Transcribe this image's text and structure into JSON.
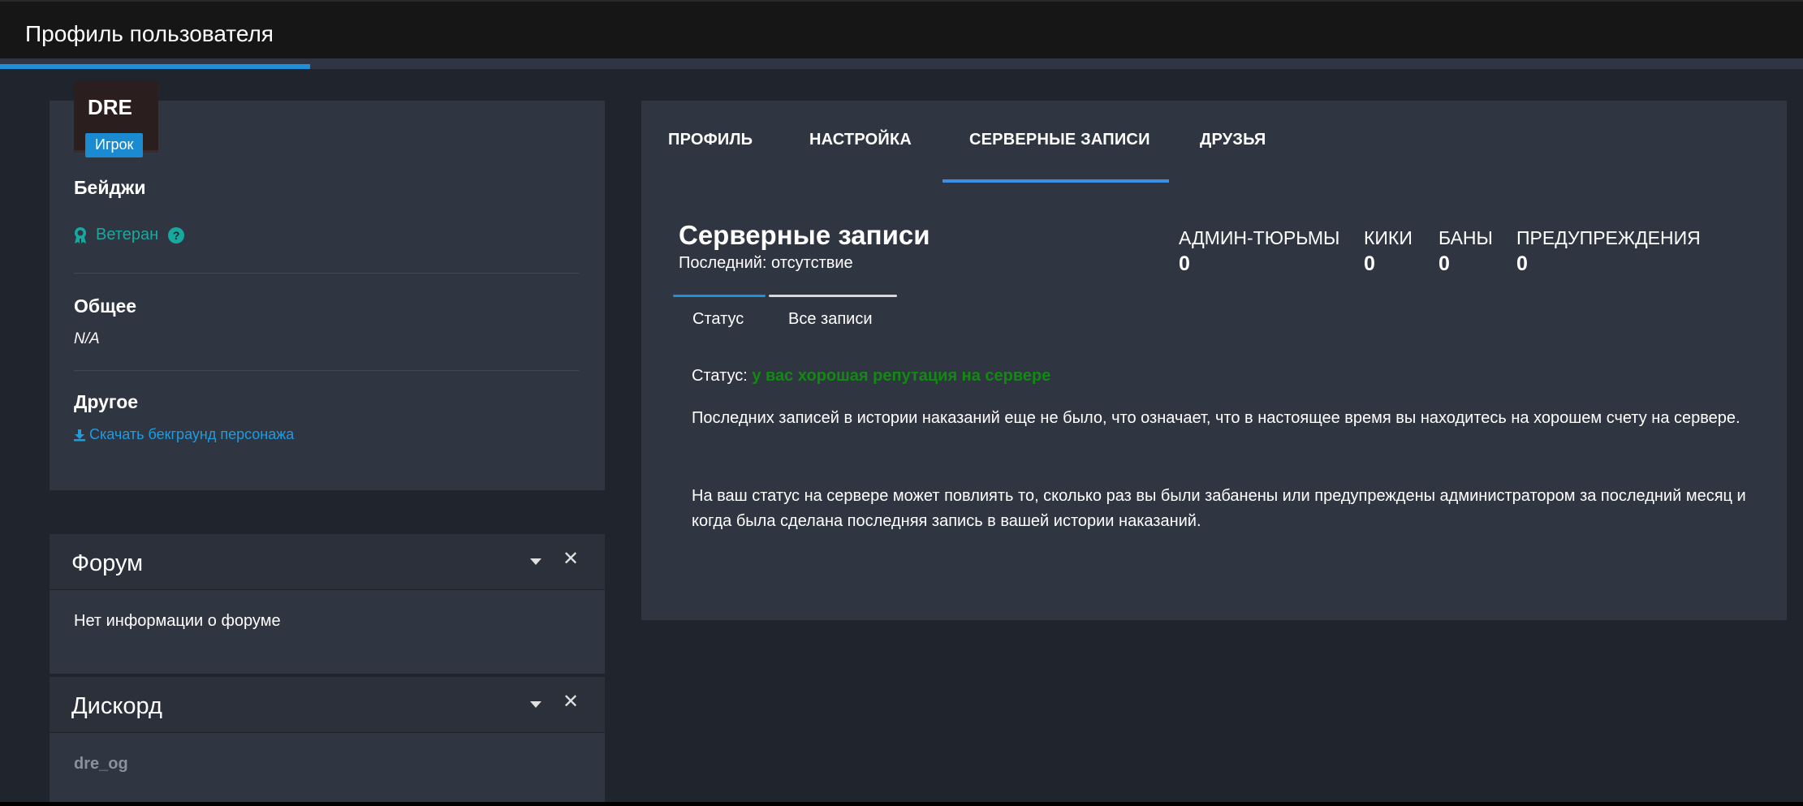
{
  "header": {
    "title": "Профиль пользователя"
  },
  "profile": {
    "name": "DRE",
    "role": "Игрок",
    "badges_title": "Бейджи",
    "badge": {
      "label": "Ветеран",
      "help": "?"
    },
    "general_title": "Общее",
    "general_value": "N/A",
    "other_title": "Другое",
    "download_label": "Скачать бекграунд персонажа"
  },
  "forum": {
    "title": "Форум",
    "body": "Нет информации о форуме"
  },
  "discord": {
    "title": "Дискорд",
    "body": "dre_og"
  },
  "tabs": [
    {
      "label": "ПРОФИЛЬ"
    },
    {
      "label": "НАСТРОЙКА"
    },
    {
      "label": "СЕРВЕРНЫЕ ЗАПИСИ",
      "active": true
    },
    {
      "label": "ДРУЗЬЯ"
    }
  ],
  "records": {
    "title": "Серверные записи",
    "subtitle": "Последний: отсутствие",
    "stats": [
      {
        "label": "АДМИН-ТЮРЬМЫ",
        "value": "0"
      },
      {
        "label": "КИКИ",
        "value": "0"
      },
      {
        "label": "БАНЫ",
        "value": "0"
      },
      {
        "label": "ПРЕДУПРЕЖДЕНИЯ",
        "value": "0"
      }
    ],
    "subtabs": [
      {
        "label": "Статус",
        "active": true
      },
      {
        "label": "Все записи"
      }
    ],
    "status_label": "Статус:",
    "status_value": "у вас хорошая репутация на сервере",
    "paragraph1": "Последних записей в истории наказаний еще не было, что означает, что в настоящее время вы находитесь на хорошем счету на сервере.",
    "paragraph2": "На ваш статус на сервере может повлиять то, сколько раз вы были забанены или предупреждены администратором за последний месяц и когда была сделана последняя запись в вашей истории наказаний."
  },
  "colors": {
    "accent": "#1f8fda",
    "tab_underline": "#3a8ee6",
    "badge_teal": "#17a9a0",
    "status_green": "#128a12",
    "panel": "#2f3541",
    "background": "#20242c"
  }
}
